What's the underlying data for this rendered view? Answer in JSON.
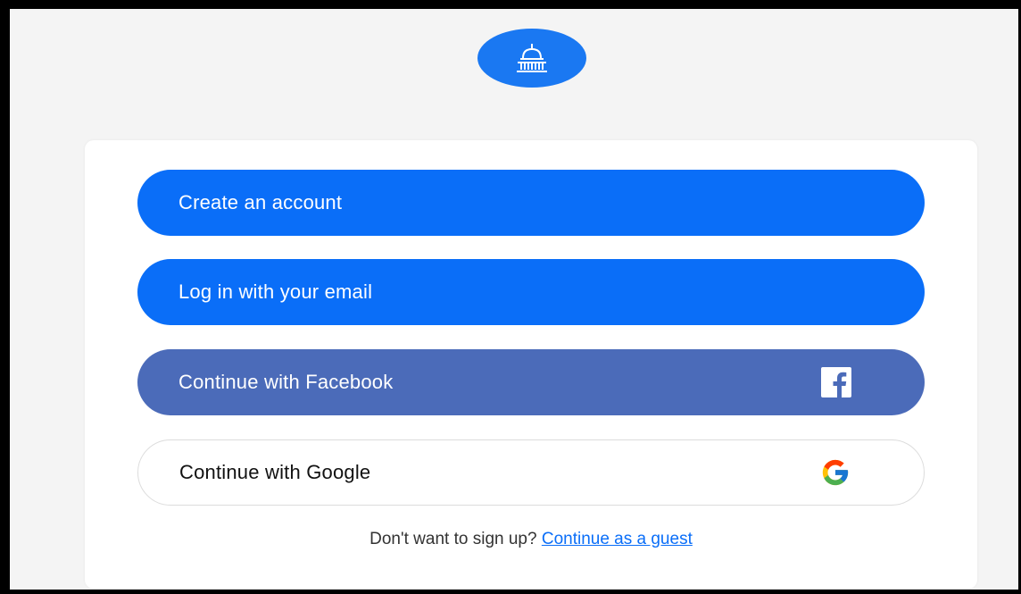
{
  "logo": {
    "icon": "capitol-dome-icon",
    "color": "#1a78f2"
  },
  "buttons": {
    "create_account": "Create an account",
    "login_email": "Log in with your email",
    "facebook": "Continue with Facebook",
    "google": "Continue with Google"
  },
  "icons": {
    "facebook": "facebook-icon",
    "google": "google-icon"
  },
  "guest": {
    "prompt": "Don't want to sign up? ",
    "link": "Continue as a guest"
  },
  "colors": {
    "primary": "#0a6ef8",
    "facebook": "#4b6bb9",
    "background": "#f4f4f4"
  }
}
